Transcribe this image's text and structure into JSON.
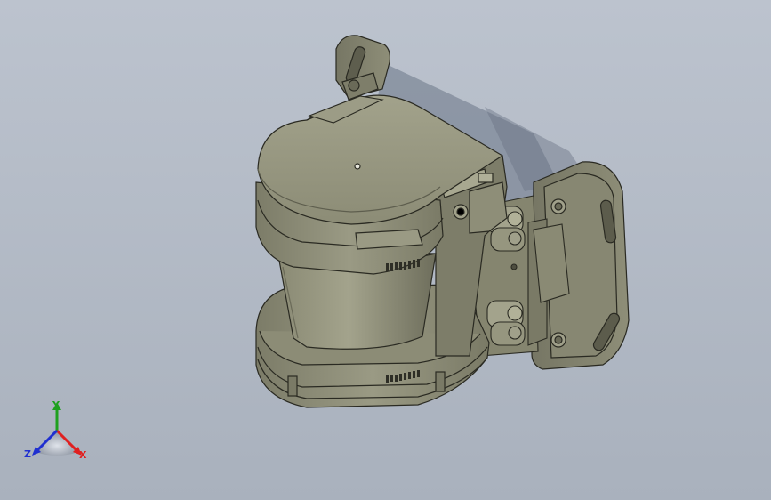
{
  "viewport": {
    "background_top": "#bcc3ce",
    "background_bottom": "#a9b1bd"
  },
  "model": {
    "body_color": "#8e8e78",
    "body_shadow_color": "#6f6f5c",
    "shadow_color": "#6a7486",
    "icon": "laser-scanner-model"
  },
  "triad": {
    "x_label": "X",
    "y_label": "Y",
    "z_label": "Z",
    "x_color": "#e02020",
    "y_color": "#1ea01e",
    "z_color": "#2030d0"
  }
}
